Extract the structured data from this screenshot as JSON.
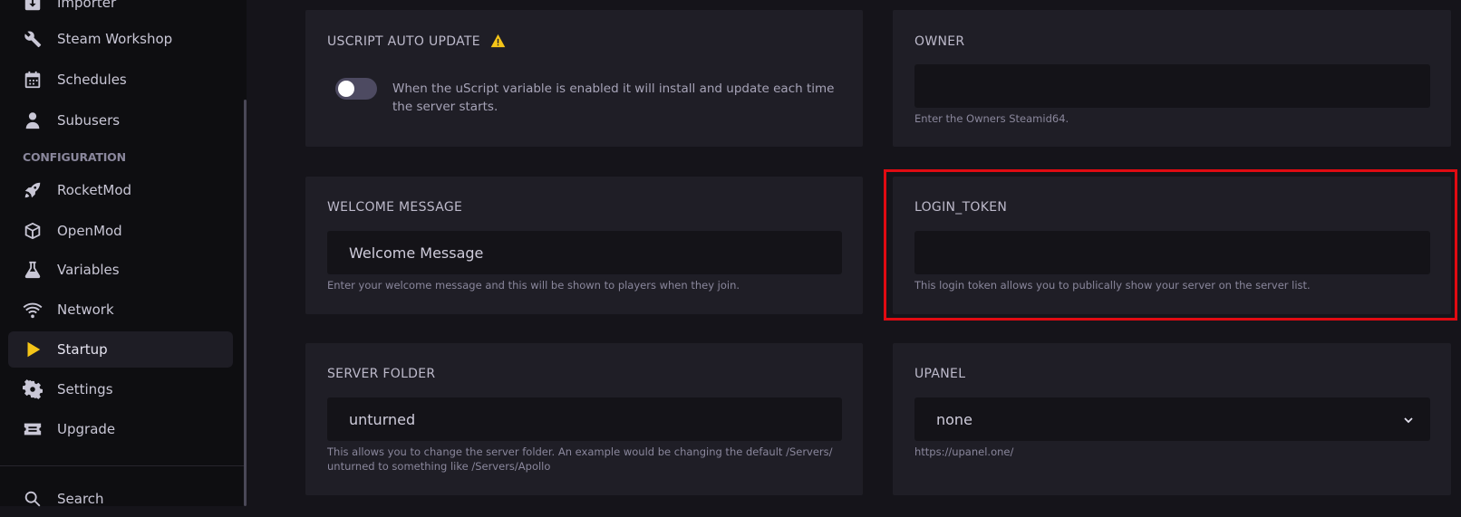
{
  "sidebar": {
    "items": [
      {
        "label": "Importer",
        "icon": "download-icon"
      },
      {
        "label": "Steam Workshop",
        "icon": "tools-icon"
      },
      {
        "label": "Schedules",
        "icon": "calendar-icon"
      },
      {
        "label": "Subusers",
        "icon": "user-icon"
      },
      {
        "label": "RocketMod",
        "icon": "rocket-icon"
      },
      {
        "label": "OpenMod",
        "icon": "cube-icon"
      },
      {
        "label": "Variables",
        "icon": "flask-icon"
      },
      {
        "label": "Network",
        "icon": "wifi-icon"
      },
      {
        "label": "Startup",
        "icon": "play-icon"
      },
      {
        "label": "Settings",
        "icon": "gear-icon"
      },
      {
        "label": "Upgrade",
        "icon": "ticket-icon"
      },
      {
        "label": "Search",
        "icon": "search-icon"
      }
    ],
    "section_configuration": "CONFIGURATION",
    "active_item": "Startup"
  },
  "cards": {
    "uscript": {
      "title": "USCRIPT AUTO UPDATE",
      "toggle_on": false,
      "description": "When the uScript variable is enabled it will install and update each time the server starts."
    },
    "owner": {
      "title": "OWNER",
      "value": "",
      "hint": "Enter the Owners Steamid64."
    },
    "welcome": {
      "title": "WELCOME MESSAGE",
      "value": "Welcome Message",
      "hint": "Enter your welcome message and this will be shown to players when they join."
    },
    "login_token": {
      "title": "LOGIN_TOKEN",
      "value": "",
      "hint": "This login token allows you to publically show your server on the server list."
    },
    "server_folder": {
      "title": "SERVER FOLDER",
      "value": "unturned",
      "hint": "This allows you to change the server folder. An example would be changing the default /Servers/ unturned to something like /Servers/Apollo"
    },
    "upanel": {
      "title": "UPANEL",
      "selected": "none",
      "hint": "https://upanel.one/"
    }
  },
  "colors": {
    "accent": "#f5c518",
    "highlight": "#e00b12",
    "warning": "#f5c518"
  }
}
